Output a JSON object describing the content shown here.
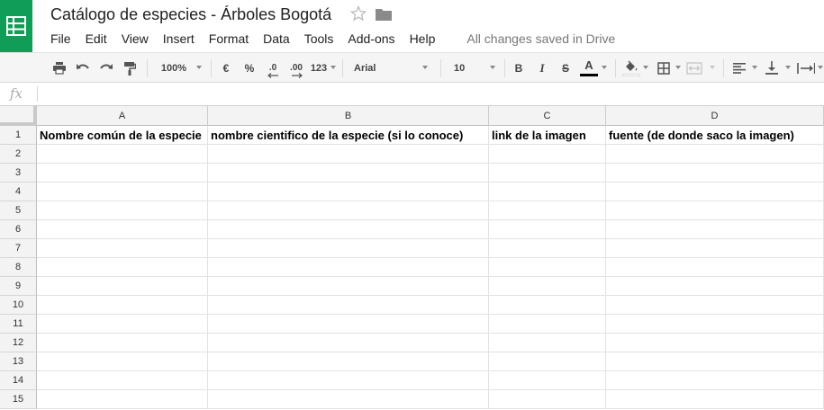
{
  "header": {
    "title": "Catálogo de especies - Árboles Bogotá",
    "save_status": "All changes saved in Drive"
  },
  "menu": [
    "File",
    "Edit",
    "View",
    "Insert",
    "Format",
    "Data",
    "Tools",
    "Add-ons",
    "Help"
  ],
  "toolbar": {
    "zoom": "100%",
    "currency": "€",
    "percent": "%",
    "decrease_decimals": ".0",
    "increase_decimals": ".00",
    "more_formats": "123",
    "font": "Arial",
    "font_size": "10",
    "bold": "B",
    "italic": "I",
    "strikethrough": "S",
    "text_color_glyph": "A",
    "icons": [
      "print-icon",
      "undo-icon",
      "redo-icon",
      "paint-format-icon",
      "fill-color-icon",
      "borders-icon",
      "merge-cells-icon",
      "align-left-icon",
      "valign-bottom-icon",
      "text-wrap-icon"
    ],
    "colors": {
      "text_color_underline": "#000000",
      "fill_color_underline": "#ffffff"
    }
  },
  "formula_bar": {
    "fx": "fx",
    "value": ""
  },
  "sheet": {
    "columns": [
      "A",
      "B",
      "C",
      "D"
    ],
    "rows": [
      "1",
      "2",
      "3",
      "4",
      "5",
      "6",
      "7",
      "8",
      "9",
      "10",
      "11",
      "12",
      "13",
      "14",
      "15"
    ],
    "row1": [
      "Nombre común de la especie",
      "nombre cientifico de la especie (si lo conoce)",
      "link de la imagen",
      "fuente (de donde saco la imagen)"
    ]
  },
  "colors": {
    "brand": "#0f9d58",
    "header_bg": "#f3f3f3",
    "toolbar_bg": "#f5f5f5"
  }
}
